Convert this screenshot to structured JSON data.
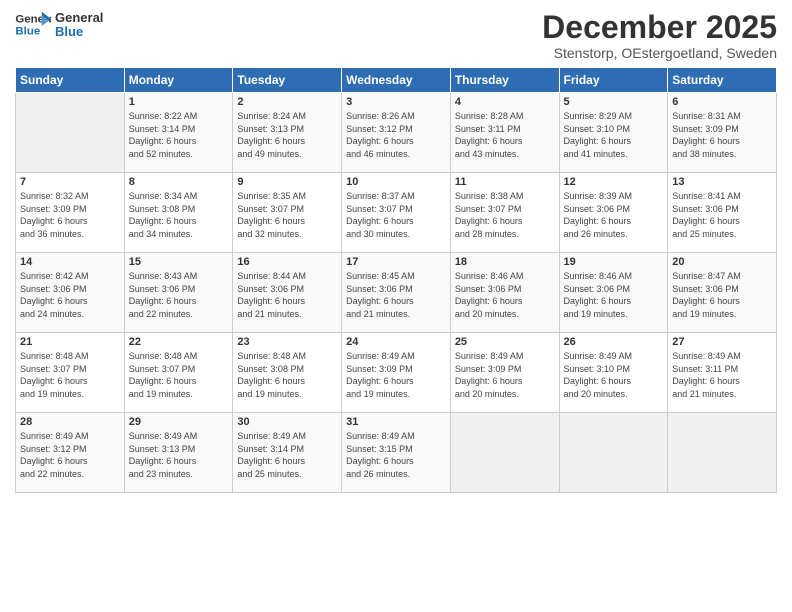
{
  "logo": {
    "line1": "General",
    "line2": "Blue"
  },
  "title": "December 2025",
  "subtitle": "Stenstorp, OEstergoetland, Sweden",
  "days_header": [
    "Sunday",
    "Monday",
    "Tuesday",
    "Wednesday",
    "Thursday",
    "Friday",
    "Saturday"
  ],
  "weeks": [
    [
      {
        "day": "",
        "info": ""
      },
      {
        "day": "1",
        "info": "Sunrise: 8:22 AM\nSunset: 3:14 PM\nDaylight: 6 hours\nand 52 minutes."
      },
      {
        "day": "2",
        "info": "Sunrise: 8:24 AM\nSunset: 3:13 PM\nDaylight: 6 hours\nand 49 minutes."
      },
      {
        "day": "3",
        "info": "Sunrise: 8:26 AM\nSunset: 3:12 PM\nDaylight: 6 hours\nand 46 minutes."
      },
      {
        "day": "4",
        "info": "Sunrise: 8:28 AM\nSunset: 3:11 PM\nDaylight: 6 hours\nand 43 minutes."
      },
      {
        "day": "5",
        "info": "Sunrise: 8:29 AM\nSunset: 3:10 PM\nDaylight: 6 hours\nand 41 minutes."
      },
      {
        "day": "6",
        "info": "Sunrise: 8:31 AM\nSunset: 3:09 PM\nDaylight: 6 hours\nand 38 minutes."
      }
    ],
    [
      {
        "day": "7",
        "info": "Sunrise: 8:32 AM\nSunset: 3:09 PM\nDaylight: 6 hours\nand 36 minutes."
      },
      {
        "day": "8",
        "info": "Sunrise: 8:34 AM\nSunset: 3:08 PM\nDaylight: 6 hours\nand 34 minutes."
      },
      {
        "day": "9",
        "info": "Sunrise: 8:35 AM\nSunset: 3:07 PM\nDaylight: 6 hours\nand 32 minutes."
      },
      {
        "day": "10",
        "info": "Sunrise: 8:37 AM\nSunset: 3:07 PM\nDaylight: 6 hours\nand 30 minutes."
      },
      {
        "day": "11",
        "info": "Sunrise: 8:38 AM\nSunset: 3:07 PM\nDaylight: 6 hours\nand 28 minutes."
      },
      {
        "day": "12",
        "info": "Sunrise: 8:39 AM\nSunset: 3:06 PM\nDaylight: 6 hours\nand 26 minutes."
      },
      {
        "day": "13",
        "info": "Sunrise: 8:41 AM\nSunset: 3:06 PM\nDaylight: 6 hours\nand 25 minutes."
      }
    ],
    [
      {
        "day": "14",
        "info": "Sunrise: 8:42 AM\nSunset: 3:06 PM\nDaylight: 6 hours\nand 24 minutes."
      },
      {
        "day": "15",
        "info": "Sunrise: 8:43 AM\nSunset: 3:06 PM\nDaylight: 6 hours\nand 22 minutes."
      },
      {
        "day": "16",
        "info": "Sunrise: 8:44 AM\nSunset: 3:06 PM\nDaylight: 6 hours\nand 21 minutes."
      },
      {
        "day": "17",
        "info": "Sunrise: 8:45 AM\nSunset: 3:06 PM\nDaylight: 6 hours\nand 21 minutes."
      },
      {
        "day": "18",
        "info": "Sunrise: 8:46 AM\nSunset: 3:06 PM\nDaylight: 6 hours\nand 20 minutes."
      },
      {
        "day": "19",
        "info": "Sunrise: 8:46 AM\nSunset: 3:06 PM\nDaylight: 6 hours\nand 19 minutes."
      },
      {
        "day": "20",
        "info": "Sunrise: 8:47 AM\nSunset: 3:06 PM\nDaylight: 6 hours\nand 19 minutes."
      }
    ],
    [
      {
        "day": "21",
        "info": "Sunrise: 8:48 AM\nSunset: 3:07 PM\nDaylight: 6 hours\nand 19 minutes."
      },
      {
        "day": "22",
        "info": "Sunrise: 8:48 AM\nSunset: 3:07 PM\nDaylight: 6 hours\nand 19 minutes."
      },
      {
        "day": "23",
        "info": "Sunrise: 8:48 AM\nSunset: 3:08 PM\nDaylight: 6 hours\nand 19 minutes."
      },
      {
        "day": "24",
        "info": "Sunrise: 8:49 AM\nSunset: 3:09 PM\nDaylight: 6 hours\nand 19 minutes."
      },
      {
        "day": "25",
        "info": "Sunrise: 8:49 AM\nSunset: 3:09 PM\nDaylight: 6 hours\nand 20 minutes."
      },
      {
        "day": "26",
        "info": "Sunrise: 8:49 AM\nSunset: 3:10 PM\nDaylight: 6 hours\nand 20 minutes."
      },
      {
        "day": "27",
        "info": "Sunrise: 8:49 AM\nSunset: 3:11 PM\nDaylight: 6 hours\nand 21 minutes."
      }
    ],
    [
      {
        "day": "28",
        "info": "Sunrise: 8:49 AM\nSunset: 3:12 PM\nDaylight: 6 hours\nand 22 minutes."
      },
      {
        "day": "29",
        "info": "Sunrise: 8:49 AM\nSunset: 3:13 PM\nDaylight: 6 hours\nand 23 minutes."
      },
      {
        "day": "30",
        "info": "Sunrise: 8:49 AM\nSunset: 3:14 PM\nDaylight: 6 hours\nand 25 minutes."
      },
      {
        "day": "31",
        "info": "Sunrise: 8:49 AM\nSunset: 3:15 PM\nDaylight: 6 hours\nand 26 minutes."
      },
      {
        "day": "",
        "info": ""
      },
      {
        "day": "",
        "info": ""
      },
      {
        "day": "",
        "info": ""
      }
    ]
  ]
}
